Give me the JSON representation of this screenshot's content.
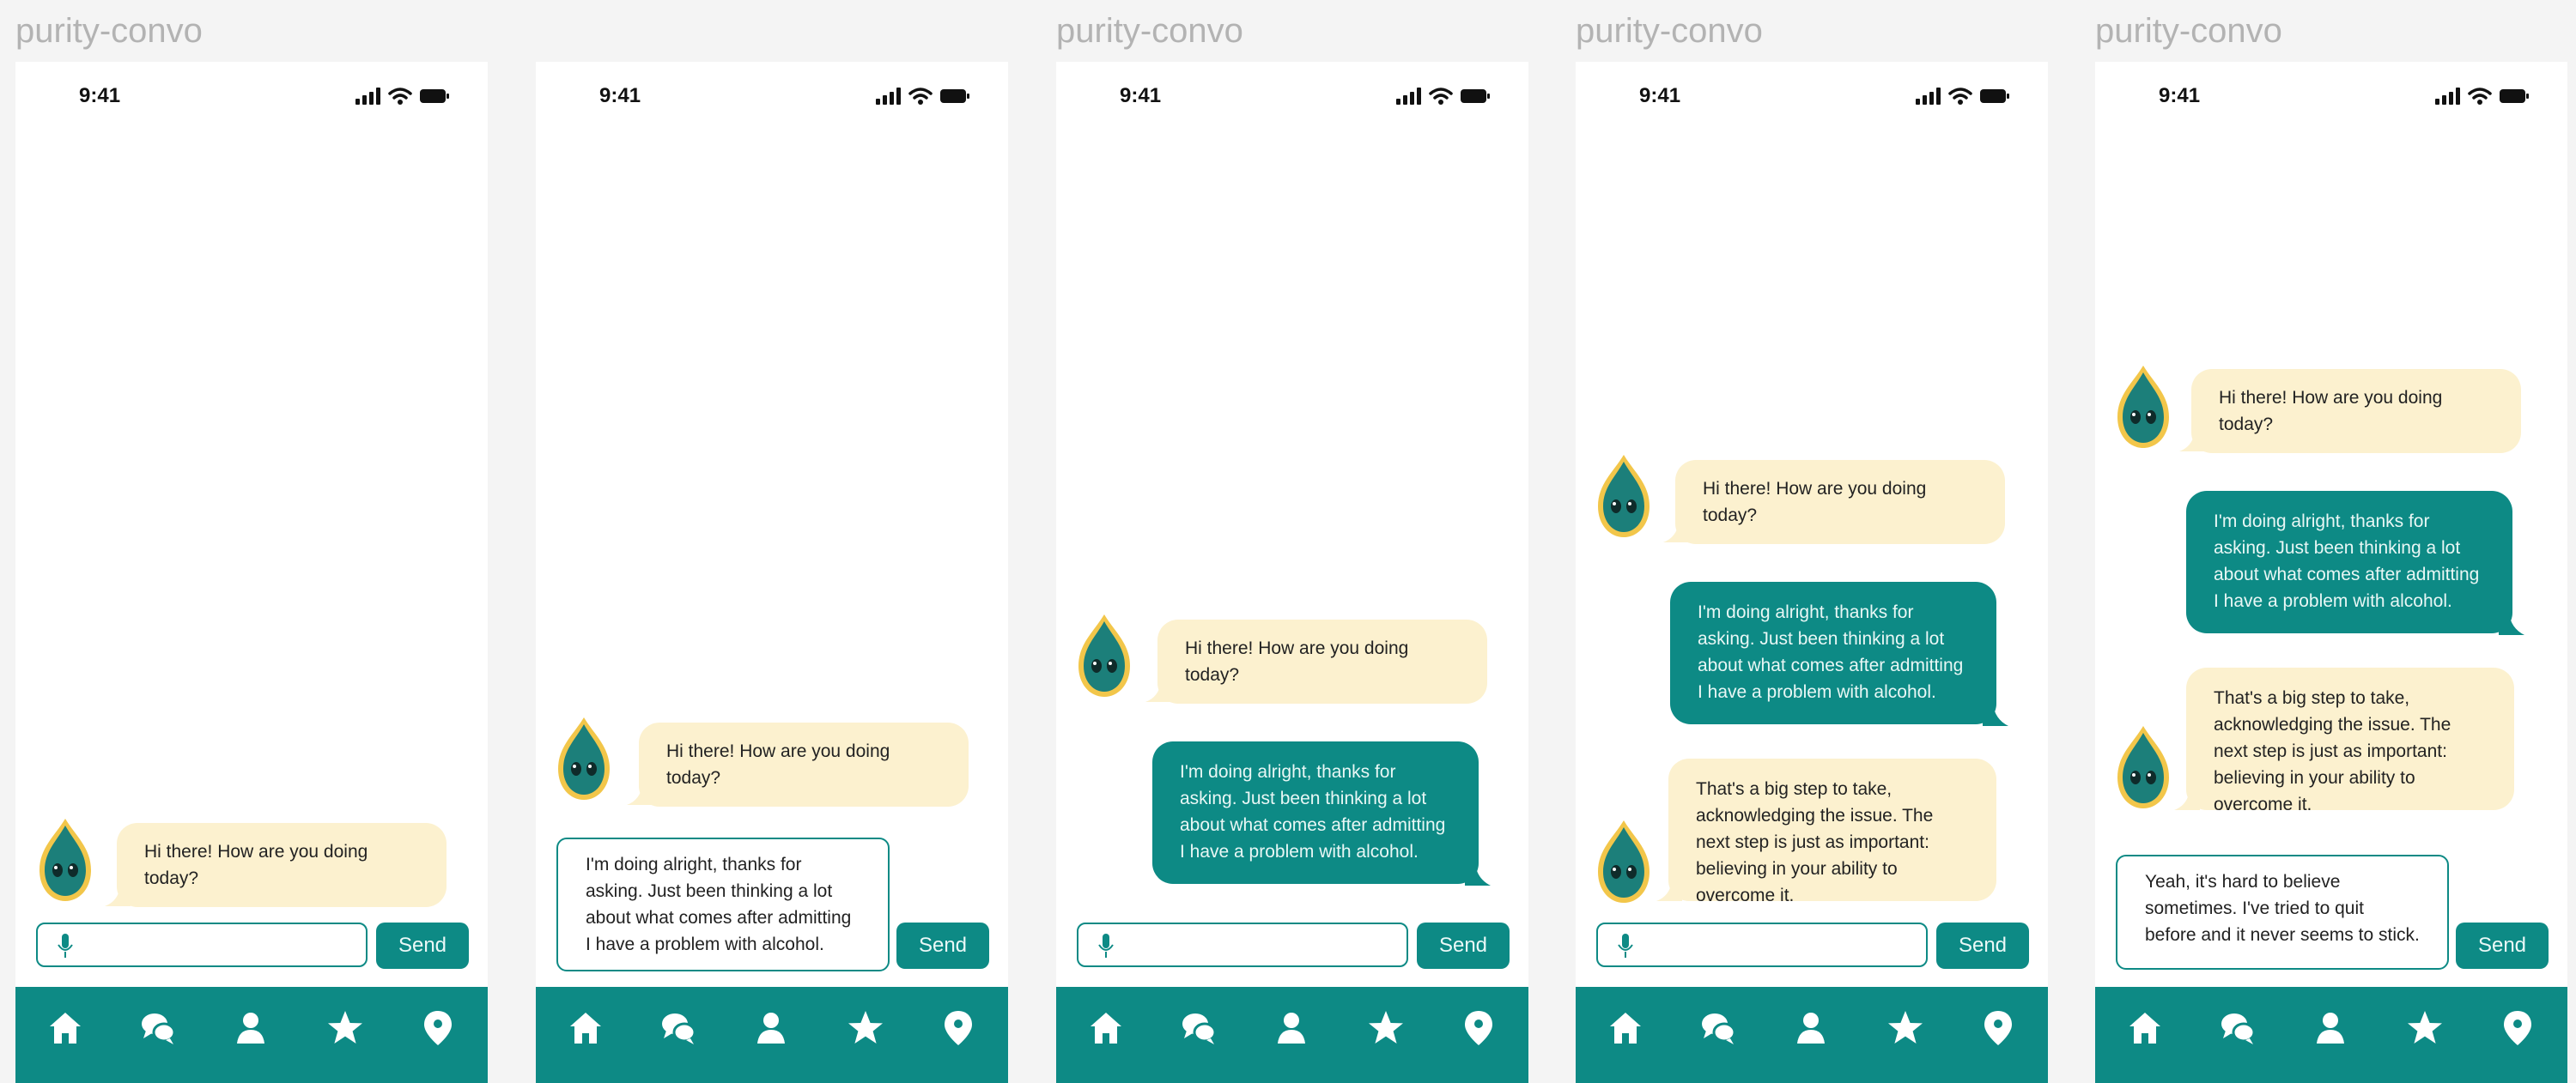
{
  "frames": [
    {
      "label": "purity-convo",
      "status_time": "9:41",
      "messages": {
        "bot1": "Hi there! How are you doing today?"
      },
      "input_placeholder": "",
      "send_label": "Send"
    },
    {
      "label": "",
      "status_time": "9:41",
      "messages": {
        "bot1": "Hi there! How are you doing today?",
        "draft": "I'm doing alright, thanks for asking. Just been thinking a lot about what comes after admitting I have a problem with alcohol."
      },
      "send_label": "Send"
    },
    {
      "label": "purity-convo",
      "status_time": "9:41",
      "messages": {
        "bot1": "Hi there! How are you doing today?",
        "user1": "I'm doing alright, thanks for asking. Just been thinking a lot about what comes after admitting I have a problem with alcohol."
      },
      "input_placeholder": "",
      "send_label": "Send"
    },
    {
      "label": "purity-convo",
      "status_time": "9:41",
      "messages": {
        "bot1": "Hi there! How are you doing today?",
        "user1": "I'm doing alright, thanks for asking. Just been thinking a lot about what comes after admitting I have a problem with alcohol.",
        "bot2": "That's a big step to take, acknowledging the issue. The next step is just as important: believing in your ability to overcome it."
      },
      "input_placeholder": "",
      "send_label": "Send"
    },
    {
      "label": "purity-convo",
      "status_time": "9:41",
      "messages": {
        "bot1": "Hi there! How are you doing today?",
        "user1": "I'm doing alright, thanks for asking. Just been thinking a lot about what comes after admitting I have a problem with alcohol.",
        "bot2": "That's a big step to take, acknowledging the issue. The next step is just as important: believing in your ability to overcome it.",
        "draft": "Yeah, it's hard to believe sometimes. I've tried to quit before and it never seems to stick."
      },
      "send_label": "Send"
    }
  ],
  "nav_icons": [
    "home-icon",
    "chat-icon",
    "profile-icon",
    "star-icon",
    "location-pin-icon"
  ],
  "colors": {
    "accent": "#0d8a85",
    "bot_bubble": "#fcf1cf",
    "background": "#f4f4f4",
    "label": "#b3b3b3"
  }
}
